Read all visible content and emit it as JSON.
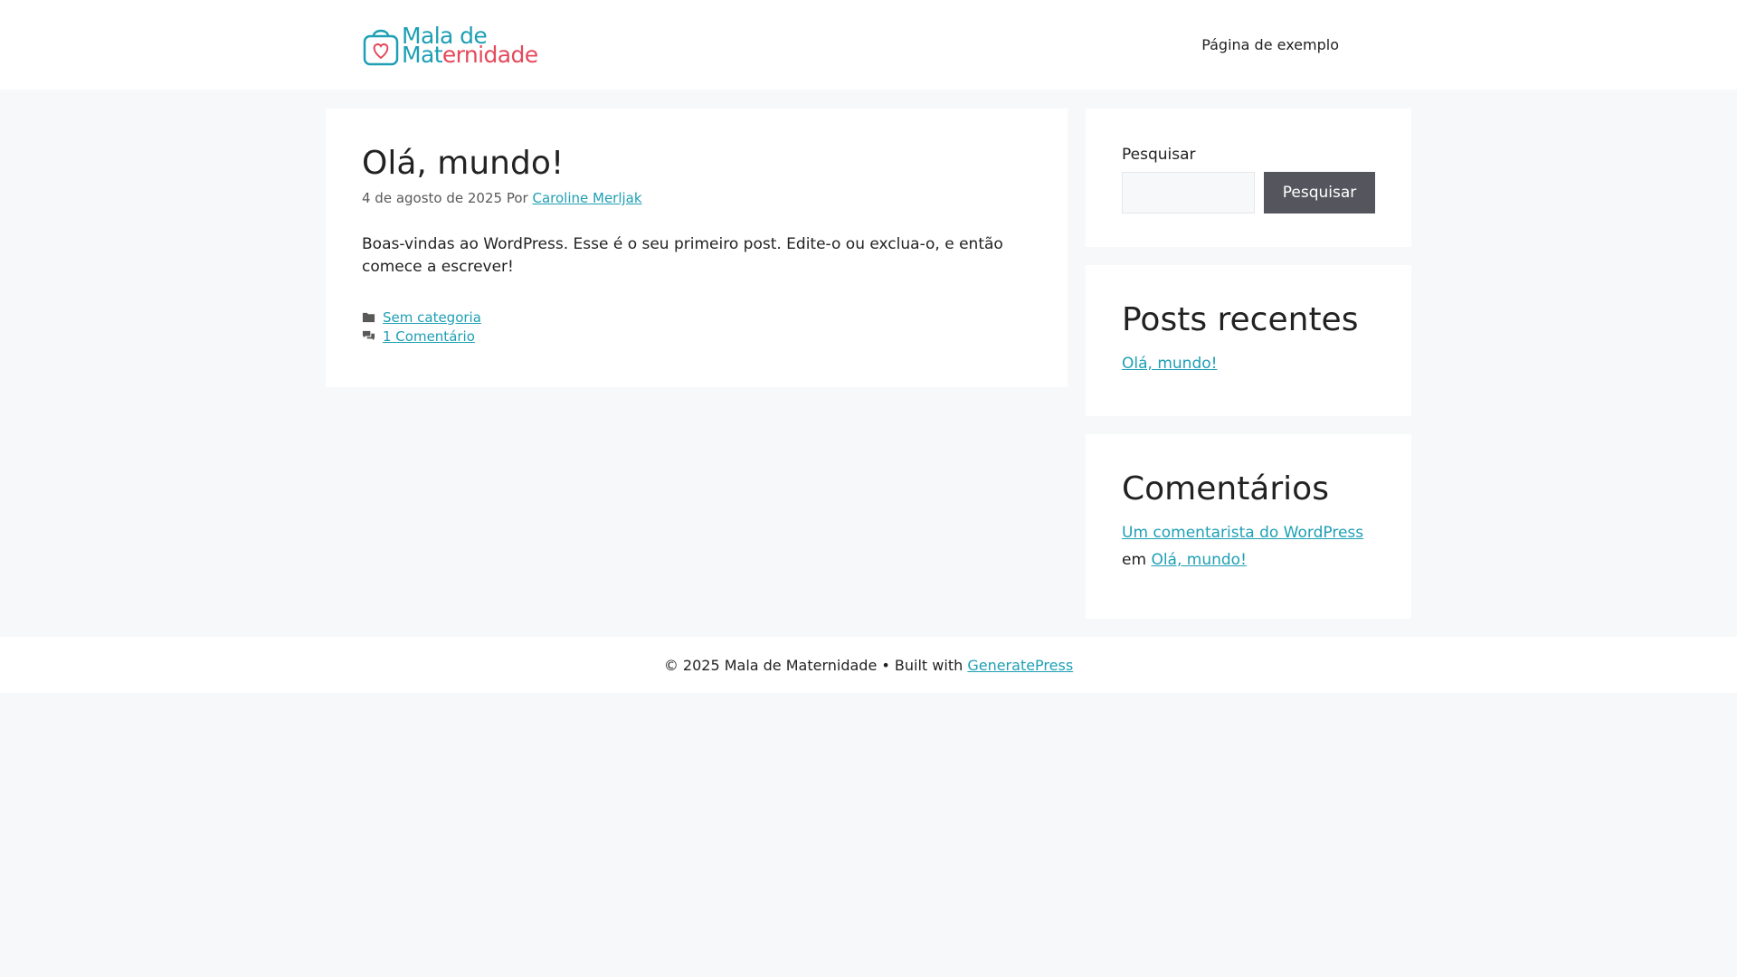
{
  "site": {
    "logo_line1": "Mala de",
    "logo_line2_part1": "Mat",
    "logo_line2_part2": "ernidade",
    "logo_colors": {
      "teal": "#1e9fb4",
      "coral": "#e4495b"
    }
  },
  "nav": {
    "items": [
      {
        "label": "Página de exemplo"
      }
    ]
  },
  "article": {
    "title": "Olá, mundo!",
    "date": "4 de agosto de 2025",
    "by": "Por",
    "author": "Caroline Merljak",
    "content": "Boas-vindas ao WordPress. Esse é o seu primeiro post. Edite-o ou exclua-o, e então comece a escrever!",
    "category": "Sem categoria",
    "comments_link": "1 Comentário",
    "icons": {
      "category": "folder-icon",
      "comments": "comments-icon"
    }
  },
  "search": {
    "label": "Pesquisar",
    "value": "",
    "button_label": "Pesquisar"
  },
  "recent_posts": {
    "title": "Posts recentes",
    "items": [
      {
        "label": "Olá, mundo!"
      }
    ]
  },
  "recent_comments": {
    "title": "Comentários",
    "author_link": "Um comentarista do WordPress",
    "connector": "em",
    "post_link": "Olá, mundo!"
  },
  "footer": {
    "text": "© 2025 Mala de Maternidade • Built with",
    "link": "GeneratePress"
  },
  "colors": {
    "background": "#f7f8f9",
    "link": "#1e9fb4",
    "button": "#55555e"
  }
}
